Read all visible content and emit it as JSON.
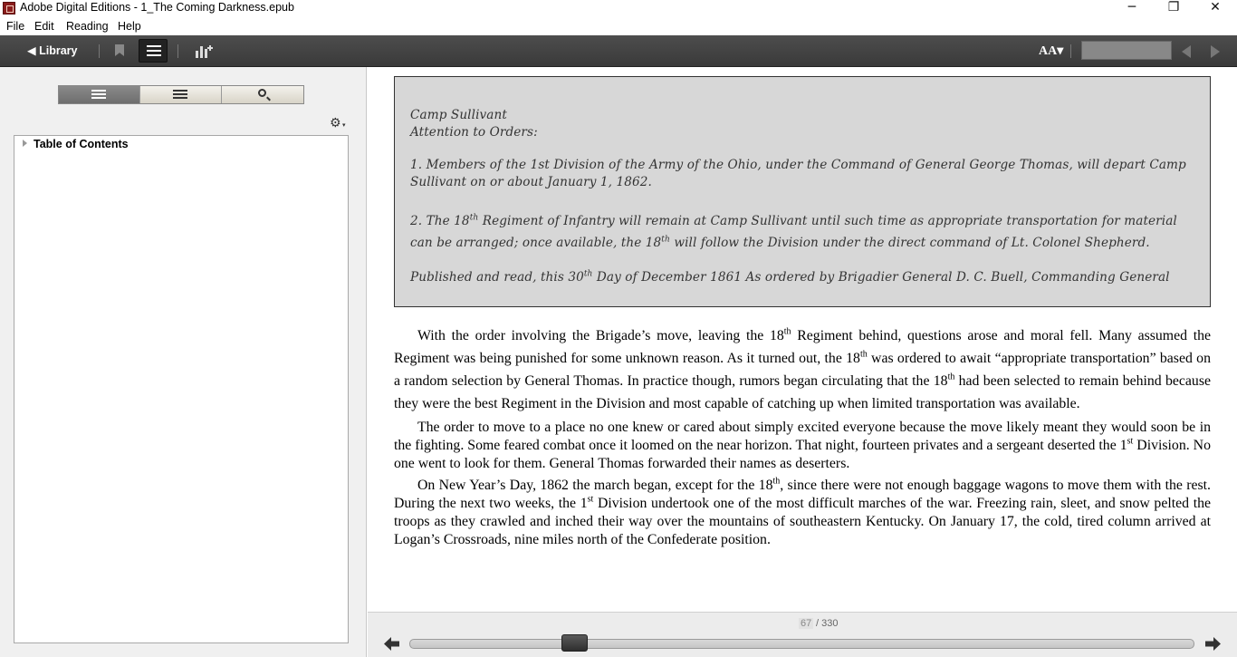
{
  "window": {
    "title": "Adobe Digital Editions - 1_The Coming Darkness.epub",
    "minimize_glyph": "─",
    "maximize_glyph": "❐",
    "close_glyph": "✕"
  },
  "menu": {
    "file": "File",
    "edit": "Edit",
    "reading": "Reading",
    "help": "Help"
  },
  "toolbar": {
    "library_label": "◀ Library",
    "font_label": "AA▾",
    "icons": [
      "bookmark-icon",
      "list-view-icon",
      "add-chart-icon",
      "font-size-icon",
      "previous-page-icon",
      "next-page-icon"
    ]
  },
  "sidebar": {
    "view_tabs": [
      "toc-view-icon",
      "annotations-view-icon",
      "search-icon"
    ],
    "gear_glyph": "⚙",
    "gear_caret": "▾",
    "toc_label": "Table of Contents"
  },
  "orders": {
    "line1": "Camp Sullivant",
    "line2": "Attention to Orders:",
    "item1": "1. Members of the 1st Division of the Army of the Ohio, under the Command of General George Thomas, will depart Camp Sullivant on or about January 1, 1862.",
    "item2_a": "2. The 18",
    "item2_sup1": "th",
    "item2_b": " Regiment of Infantry will remain at Camp Sullivant until such time as appropriate transportation for material can be arranged; once available, the 18",
    "item2_sup2": "th",
    "item2_c": " will follow the Division under the direct command of Lt. Colonel Shepherd.",
    "pub_a": "Published and read, this 30",
    "pub_sup": "th",
    "pub_b": " Day of December 1861 As ordered by Brigadier General D. C. Buell, Commanding General"
  },
  "body": {
    "p1_a": "With the order involving the Brigade’s move, leaving the 18",
    "p1_s1": "th",
    "p1_b": " Regiment behind, questions arose and moral fell. Many assumed the Regiment was being punished for some unknown reason. As it turned out, the 18",
    "p1_s2": "th",
    "p1_c": " was ordered to await “appropriate transportation” based on a random selection by General Thomas. In practice though, rumors began circulating that the 18",
    "p1_s3": "th",
    "p1_d": " had been selected to remain behind because they were the best Regiment in the Division and most capable of catching up when limited transportation was available.",
    "p2_a": "The order to move to a place no one knew or cared about simply excited everyone because the move likely meant they would soon be in the fighting. Some feared combat once it loomed on the near horizon. That night, fourteen privates and a sergeant deserted the 1",
    "p2_s1": "st",
    "p2_b": " Division. No one went to look for them. General Thomas forwarded their names as deserters.",
    "p3_a": "On New Year’s Day, 1862 the march began, except for the 18",
    "p3_s1": "th",
    "p3_b": ", since there were not enough baggage wagons to move them with the rest. During the next two weeks, the 1",
    "p3_s2": "st",
    "p3_c": " Division undertook one of the most difficult marches of the war. Freezing rain, sleet, and snow pelted the troops as they crawled and inched their way over the mountains of southeastern Kentucky. On January 17, the cold, tired column arrived at Logan’s Crossroads, nine miles north of the Confederate position."
  },
  "pager": {
    "current_page": "67",
    "total_pages": "/ 330",
    "page_number": 67,
    "page_count": 330,
    "icons": [
      "previous-page-arrow-icon",
      "next-page-arrow-icon"
    ]
  }
}
